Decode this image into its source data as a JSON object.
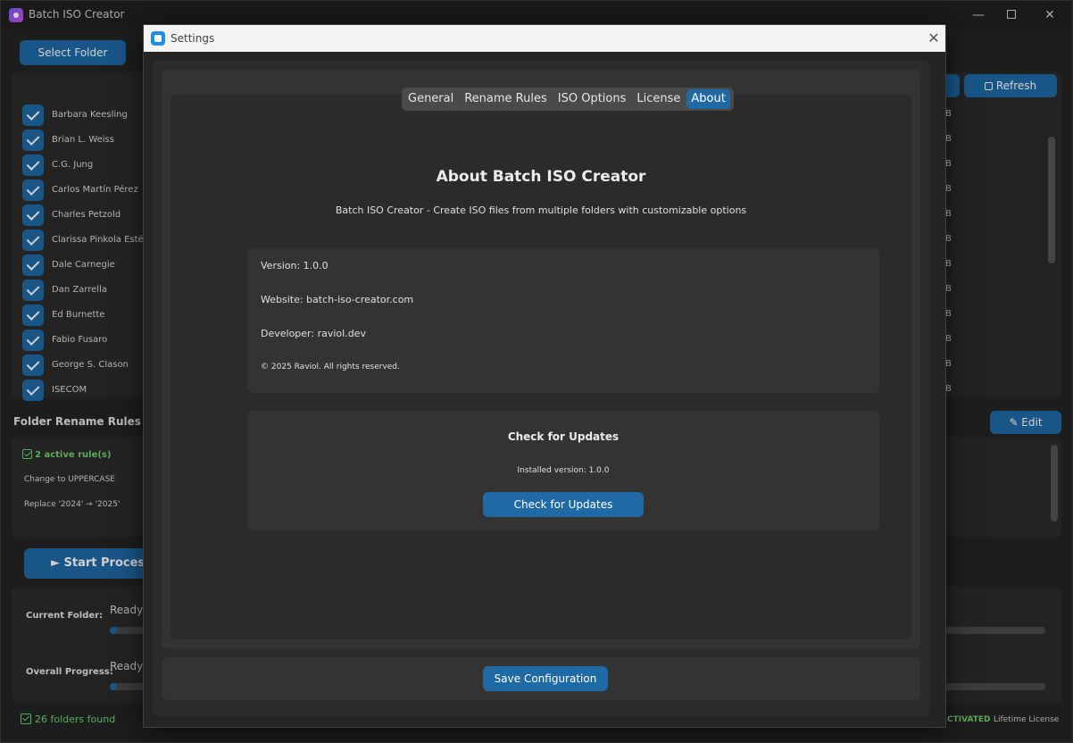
{
  "window": {
    "title": "Batch ISO Creator",
    "minimize_glyph": "—",
    "close_glyph": "✕"
  },
  "toolbar": {
    "select_folder_label": "Select Folder",
    "refresh_label": "Refresh",
    "edit_label": "✎ Edit"
  },
  "folders": [
    {
      "name": "Barbara Keesling",
      "size": "B"
    },
    {
      "name": "Brian L. Weiss",
      "size": "B"
    },
    {
      "name": "C.G. Jung",
      "size": "B"
    },
    {
      "name": "Carlos Martín Pérez",
      "size": "B"
    },
    {
      "name": "Charles Petzold",
      "size": "B"
    },
    {
      "name": "Clarissa Pinkola Estés",
      "size": "B"
    },
    {
      "name": "Dale Carnegie",
      "size": "B"
    },
    {
      "name": "Dan Zarrella",
      "size": "B"
    },
    {
      "name": "Ed Burnette",
      "size": "B"
    },
    {
      "name": "Fabio Fusaro",
      "size": "B"
    },
    {
      "name": "George S. Clason",
      "size": "B"
    },
    {
      "name": "ISECOM",
      "size": "B"
    }
  ],
  "rename_rules": {
    "title": "Folder Rename Rules",
    "active_summary": "2 active rule(s)",
    "rules": [
      "Change to UPPERCASE",
      "Replace '2024' → '2025'"
    ]
  },
  "processing": {
    "start_label": "► Start Processi",
    "current_folder_label": "Current Folder:",
    "current_status": "Ready t",
    "current_progress": 0.008,
    "overall_label": "Overall Progress:",
    "overall_status": "Ready t",
    "overall_progress": 0.008
  },
  "statusbar": {
    "folders_found": "26 folders found",
    "activated": "CTIVATED",
    "license": "Lifetime License"
  },
  "dialog": {
    "title": "Settings",
    "close_glyph": "✕",
    "tabs": [
      {
        "label": "General",
        "active": false
      },
      {
        "label": "Rename Rules",
        "active": false
      },
      {
        "label": "ISO Options",
        "active": false
      },
      {
        "label": "License",
        "active": false
      },
      {
        "label": "About",
        "active": true
      }
    ],
    "about": {
      "heading": "About Batch ISO Creator",
      "description": "Batch ISO Creator - Create ISO files from multiple folders with customizable options",
      "version": "Version: 1.0.0",
      "website": "Website: batch-iso-creator.com",
      "developer": "Developer: raviol.dev",
      "copyright": "© 2025 Raviol. All rights reserved."
    },
    "updates": {
      "heading": "Check for Updates",
      "installed": "Installed version: 1.0.0",
      "button_label": "Check for Updates"
    },
    "save_label": "Save Configuration"
  },
  "colors": {
    "accent": "#1f6aa5",
    "success": "#6fd36f",
    "background": "#242424",
    "panel": "#2b2b2b"
  }
}
